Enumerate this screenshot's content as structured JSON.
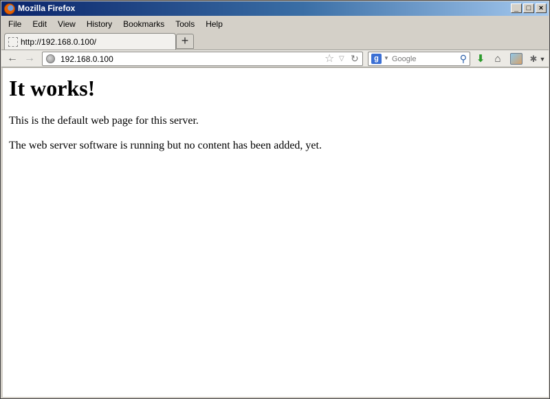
{
  "window": {
    "title": "Mozilla Firefox"
  },
  "window_controls": {
    "minimize": "_",
    "maximize": "□",
    "close": "×"
  },
  "menu": [
    "File",
    "Edit",
    "View",
    "History",
    "Bookmarks",
    "Tools",
    "Help"
  ],
  "tab": {
    "label": "http://192.168.0.100/",
    "new_tab_symbol": "+"
  },
  "navigation": {
    "back_icon": "←",
    "forward_icon": "→",
    "url": "192.168.0.100"
  },
  "search": {
    "placeholder": "Google",
    "engine_icon": "g"
  },
  "toolbar_icons": [
    "download-icon",
    "home-icon",
    "persona-icon",
    "tools-icon"
  ],
  "page": {
    "heading": "It works!",
    "paragraphs": [
      "This is the default web page for this server.",
      "The web server software is running but no content has been added, yet."
    ]
  },
  "colors": {
    "titlebar_start": "#0a246a",
    "titlebar_end": "#a6caf0",
    "download_arrow": "#2b9a2b"
  }
}
